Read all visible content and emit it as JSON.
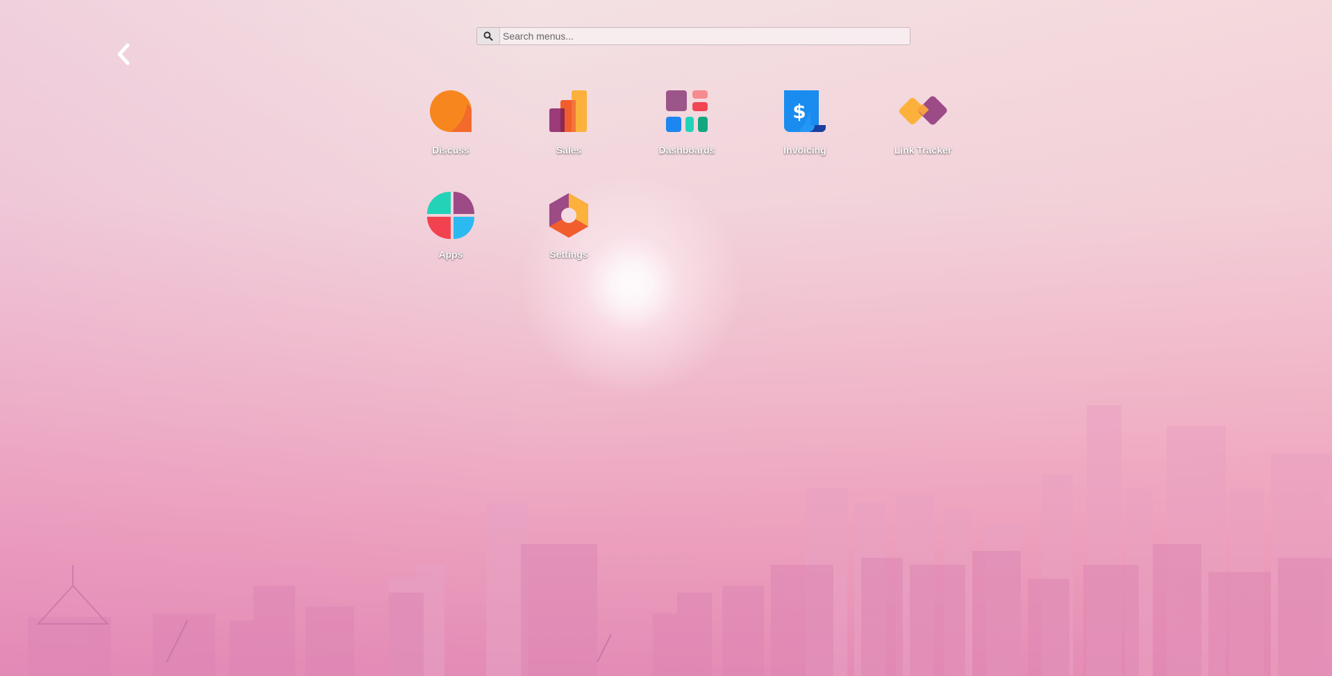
{
  "search": {
    "placeholder": "Search menus..."
  },
  "navigation": {
    "back_icon": "chevron-left-icon"
  },
  "apps": [
    {
      "label": "Discuss",
      "icon": "discuss-icon"
    },
    {
      "label": "Sales",
      "icon": "sales-icon"
    },
    {
      "label": "Dashboards",
      "icon": "dashboards-icon"
    },
    {
      "label": "Invoicing",
      "icon": "invoicing-icon"
    },
    {
      "label": "Link Tracker",
      "icon": "link-tracker-icon"
    },
    {
      "label": "Apps",
      "icon": "apps-icon"
    },
    {
      "label": "Settings",
      "icon": "settings-icon"
    }
  ],
  "colors": {
    "background_top": "#f3e1e3",
    "background_bottom": "#e38bb5",
    "label_text": "#ffffff"
  }
}
